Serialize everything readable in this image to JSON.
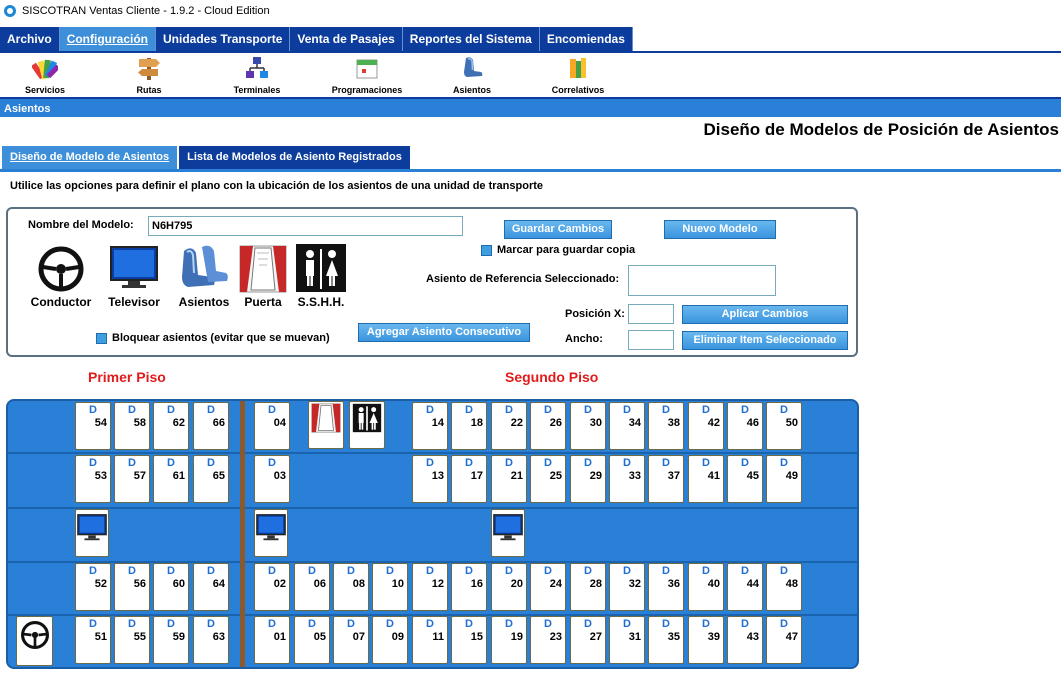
{
  "window": {
    "title": "SISCOTRAN Ventas Cliente - 1.9.2 - Cloud Edition"
  },
  "menu": [
    "Archivo",
    "Configuración",
    "Unidades Transporte",
    "Venta de Pasajes",
    "Reportes del Sistema",
    "Encomiendas"
  ],
  "toolbar": [
    "Servicios",
    "Rutas",
    "Terminales",
    "Programaciones",
    "Asientos",
    "Correlativos"
  ],
  "section": "Asientos",
  "page_title": "Diseño de Modelos de Posición de Asientos",
  "tabs": [
    "Diseño de Modelo de Asientos",
    "Lista de Modelos de Asiento Registrados"
  ],
  "instructions": "Utilice las opciones para definir el plano con la ubicación de los asientos de una unidad de transporte",
  "form": {
    "model_name_label": "Nombre del Modelo:",
    "model_name_value": "N6H795",
    "save_button": "Guardar Cambios",
    "new_button": "Nuevo Modelo",
    "save_copy_label": "Marcar para guardar copia",
    "ref_seat_label": "Asiento de Referencia Seleccionado:",
    "ref_seat_value": "",
    "pos_x_label": "Posición X:",
    "pos_x_value": "",
    "width_label": "Ancho:",
    "width_value": "",
    "apply_button": "Aplicar Cambios",
    "delete_button": "Eliminar Item Seleccionado",
    "add_consecutive_button": "Agregar Asiento Consecutivo",
    "lock_label": "Bloquear asientos (evitar que se muevan)"
  },
  "palette": [
    "Conductor",
    "Televisor",
    "Asientos",
    "Puerta",
    "S.S.H.H."
  ],
  "floors": {
    "first": "Primer Piso",
    "second": "Segundo Piso"
  },
  "seat_side": "D",
  "rows": [
    [
      "54",
      "58",
      "62",
      "66",
      "04",
      "14",
      "18",
      "22",
      "26",
      "30",
      "34",
      "38",
      "42",
      "46",
      "50"
    ],
    [
      "53",
      "57",
      "61",
      "65",
      "03",
      "13",
      "17",
      "21",
      "25",
      "29",
      "33",
      "37",
      "41",
      "45",
      "49"
    ],
    [
      "52",
      "56",
      "60",
      "64",
      "02",
      "06",
      "08",
      "10",
      "12",
      "16",
      "20",
      "24",
      "28",
      "32",
      "36",
      "40",
      "44",
      "48"
    ],
    [
      "51",
      "55",
      "59",
      "63",
      "01",
      "05",
      "07",
      "09",
      "11",
      "15",
      "19",
      "23",
      "27",
      "31",
      "35",
      "39",
      "43",
      "47"
    ]
  ],
  "colors": {
    "menu_bg": "#0c3c9c",
    "menu_active": "#3d8fd9",
    "bus_bg": "#2a7fd6",
    "divider": "#8a5a2c",
    "floor_label": "#e01c1c",
    "seat_letter": "#1e6fd0"
  }
}
